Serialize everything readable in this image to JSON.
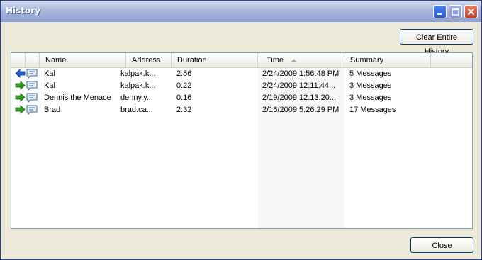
{
  "window": {
    "title": "History"
  },
  "titlebar_buttons": [
    "minimize-icon",
    "maximize-icon",
    "close-icon"
  ],
  "toolbar": {
    "clear_label": "Clear Entire History"
  },
  "footer": {
    "close_label": "Close"
  },
  "columns": [
    "Name",
    "Address",
    "Duration",
    "Time",
    "Summary"
  ],
  "sorted_column": "Time",
  "rows": [
    {
      "direction": "incoming",
      "name": "Kal",
      "address": "kalpak.k...",
      "duration": "2:56",
      "time": "2/24/2009 1:56:48 PM",
      "summary": "5 Messages"
    },
    {
      "direction": "outgoing",
      "name": "Kal",
      "address": "kalpak.k...",
      "duration": "0:22",
      "time": "2/24/2009 12:11:44...",
      "summary": "3 Messages"
    },
    {
      "direction": "outgoing",
      "name": "Dennis the Menace",
      "address": "denny.y...",
      "duration": "0:16",
      "time": "2/19/2009 12:13:20...",
      "summary": "3 Messages"
    },
    {
      "direction": "outgoing",
      "name": "Brad",
      "address": "brad.ca...",
      "duration": "2:32",
      "time": "2/16/2009 5:26:29 PM",
      "summary": "17 Messages"
    }
  ],
  "colors": {
    "incoming_arrow": "#1e5fd6",
    "outgoing_arrow": "#2f9e1f",
    "chat_icon": "#3a6a9a"
  }
}
